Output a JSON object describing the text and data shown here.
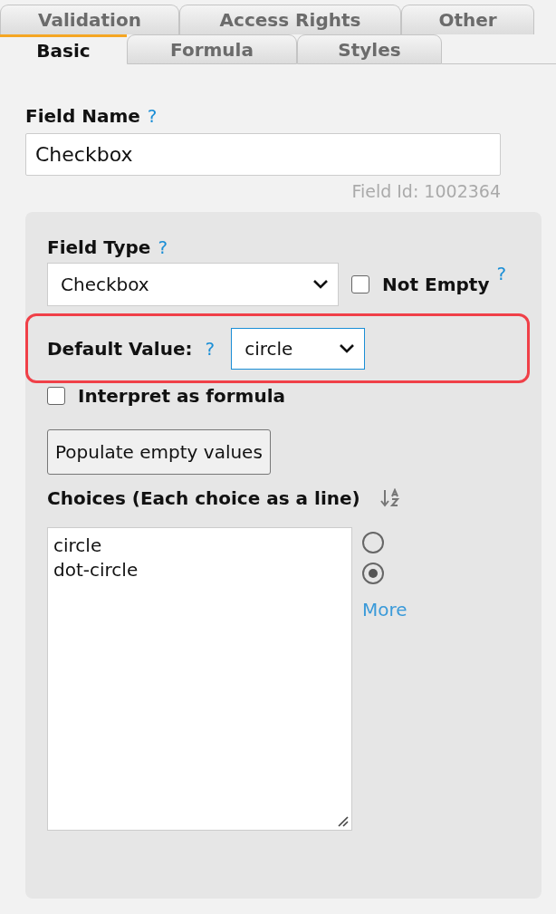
{
  "tabs_back_row": [
    {
      "label": "Validation",
      "selected": false
    },
    {
      "label": "Access Rights",
      "selected": false
    },
    {
      "label": "Other",
      "selected": false
    }
  ],
  "tabs_front_row": [
    {
      "label": "Basic",
      "selected": true
    },
    {
      "label": "Formula",
      "selected": false
    },
    {
      "label": "Styles",
      "selected": false
    }
  ],
  "field_name": {
    "label": "Field Name",
    "help": "?",
    "value": "Checkbox",
    "field_id": "Field Id: 1002364"
  },
  "field_type": {
    "label": "Field Type",
    "help": "?",
    "value": "Checkbox"
  },
  "not_empty": {
    "label": "Not Empty",
    "help": "?",
    "checked": false
  },
  "default_value": {
    "label": "Default Value:",
    "help": "?",
    "value": "circle",
    "highlighted": true
  },
  "interpret_as_formula": {
    "label": "Interpret as formula",
    "checked": false
  },
  "populate_button": "Populate empty values",
  "choices": {
    "label": "Choices (Each choice as a line)",
    "lines": [
      "circle",
      "dot-circle"
    ],
    "radios": [
      {
        "selected": false
      },
      {
        "selected": true
      }
    ],
    "more_link": "More"
  }
}
